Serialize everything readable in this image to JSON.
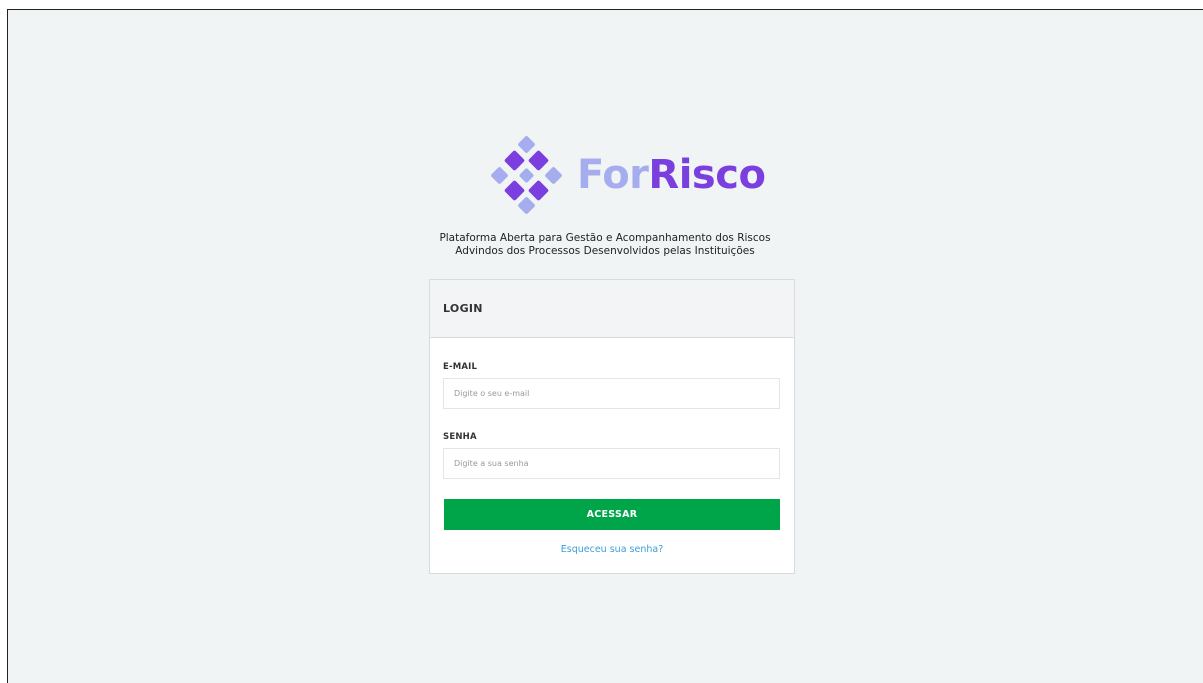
{
  "brand": {
    "name_light": "For",
    "name_dark": "Risco",
    "tagline_line1": "Plataforma Aberta para Gestão e Acompanhamento dos Riscos",
    "tagline_line2": "Advindos dos Processos Desenvolvidos pelas Instituições",
    "colors": {
      "light": "#a6adee",
      "dark": "#7b3fe0"
    }
  },
  "login": {
    "title": "LOGIN",
    "email_label": "E-MAIL",
    "email_placeholder": "Digite o seu e-mail",
    "password_label": "SENHA",
    "password_placeholder": "Digite a sua senha",
    "submit_label": "ACESSAR",
    "forgot_label": "Esqueceu sua senha?",
    "button_color": "#00a54a",
    "link_color": "#3b9fd8"
  }
}
